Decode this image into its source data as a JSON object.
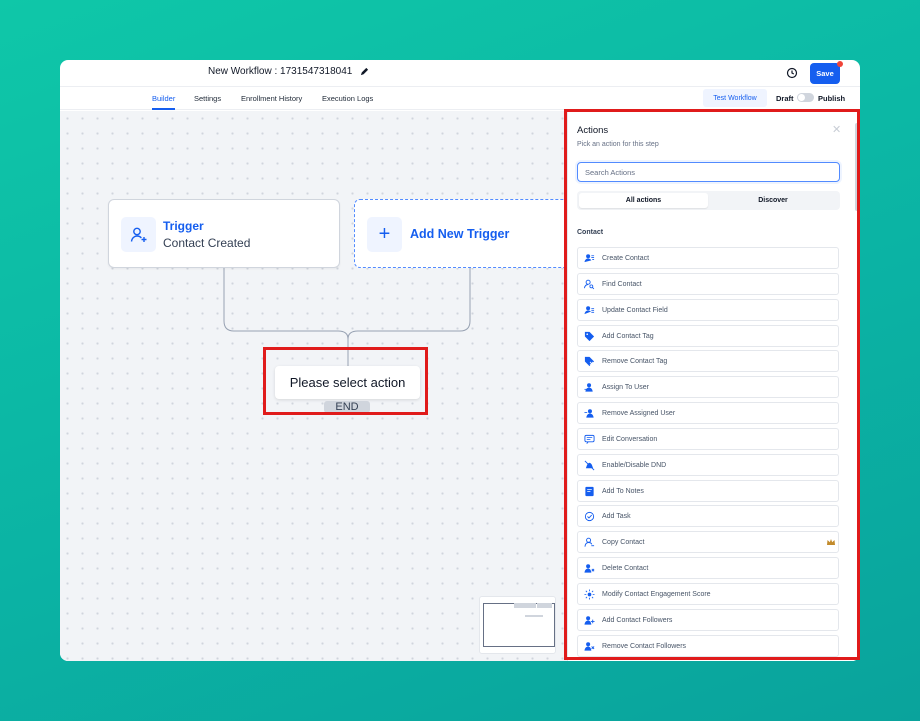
{
  "header": {
    "workflow_title": "New Workflow : 1731547318041",
    "save_label": "Save"
  },
  "nav": {
    "tabs": [
      {
        "label": "Builder",
        "active": true
      },
      {
        "label": "Settings",
        "active": false
      },
      {
        "label": "Enrollment History",
        "active": false
      },
      {
        "label": "Execution Logs",
        "active": false
      }
    ],
    "test_workflow_label": "Test Workflow",
    "draft_label": "Draft",
    "publish_label": "Publish",
    "published": false
  },
  "canvas": {
    "trigger": {
      "title": "Trigger",
      "subtitle": "Contact Created",
      "icon": "user-plus-icon"
    },
    "add_trigger_label": "Add New Trigger",
    "action_placeholder": "Please select action",
    "end_label": "END"
  },
  "panel": {
    "title": "Actions",
    "subtitle": "Pick an action for this step",
    "search_placeholder": "Search Actions",
    "segments": [
      "All actions",
      "Discover"
    ],
    "active_segment": "All actions",
    "section_label": "Contact",
    "actions": [
      {
        "label": "Create Contact",
        "icon": "user-lines-icon"
      },
      {
        "label": "Find Contact",
        "icon": "user-search-icon"
      },
      {
        "label": "Update Contact Field",
        "icon": "user-edit-icon"
      },
      {
        "label": "Add Contact Tag",
        "icon": "tag-icon"
      },
      {
        "label": "Remove Contact Tag",
        "icon": "tag-remove-icon"
      },
      {
        "label": "Assign To User",
        "icon": "user-assign-icon"
      },
      {
        "label": "Remove Assigned User",
        "icon": "user-remove-icon"
      },
      {
        "label": "Edit Conversation",
        "icon": "chat-icon"
      },
      {
        "label": "Enable/Disable DND",
        "icon": "bell-off-icon"
      },
      {
        "label": "Add To Notes",
        "icon": "note-icon"
      },
      {
        "label": "Add Task",
        "icon": "task-check-icon"
      },
      {
        "label": "Copy Contact",
        "icon": "user-copy-icon",
        "premium": true
      },
      {
        "label": "Delete Contact",
        "icon": "user-delete-icon"
      },
      {
        "label": "Modify Contact Engagement Score",
        "icon": "sparkle-icon"
      },
      {
        "label": "Add Contact Followers",
        "icon": "users-plus-icon"
      },
      {
        "label": "Remove Contact Followers",
        "icon": "users-x-icon"
      }
    ]
  },
  "colors": {
    "accent": "#155eef",
    "highlight": "#e01b1b",
    "background": "#0fc7a8",
    "crown": "#c28b2c"
  }
}
